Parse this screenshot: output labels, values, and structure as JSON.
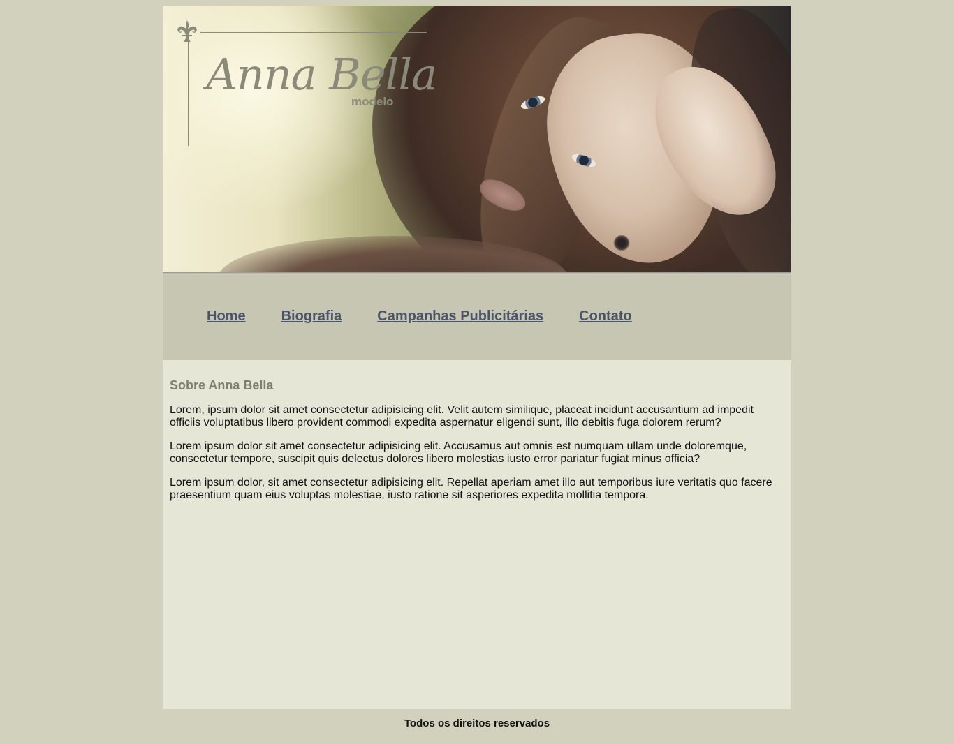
{
  "logo": {
    "name": "Anna Bella",
    "subtitle": "modelo"
  },
  "nav": {
    "items": [
      {
        "label": "Home"
      },
      {
        "label": "Biografia"
      },
      {
        "label": "Campanhas Publicitárias"
      },
      {
        "label": "Contato"
      }
    ]
  },
  "main": {
    "heading": "Sobre Anna Bella",
    "paragraphs": [
      "Lorem, ipsum dolor sit amet consectetur adipisicing elit. Velit autem similique, placeat incidunt accusantium ad impedit officiis voluptatibus libero provident commodi expedita aspernatur eligendi sunt, illo debitis fuga dolorem rerum?",
      "Lorem ipsum dolor sit amet consectetur adipisicing elit. Accusamus aut omnis est numquam ullam unde doloremque, consectetur tempore, suscipit quis delectus dolores libero molestias iusto error pariatur fugiat minus officia?",
      "Lorem ipsum dolor, sit amet consectetur adipisicing elit. Repellat aperiam amet illo aut temporibus iure veritatis quo facere praesentium quam eius voluptas molestiae, iusto ratione sit asperiores expedita mollitia tempora."
    ]
  },
  "footer": {
    "text": "Todos os direitos reservados"
  },
  "colors": {
    "page_bg": "#d1d1be",
    "nav_bg": "#c6c6b3",
    "main_bg": "#e6e6d7",
    "link": "#4b5567",
    "heading": "#7f7f70",
    "logo": "#8b8a78"
  }
}
